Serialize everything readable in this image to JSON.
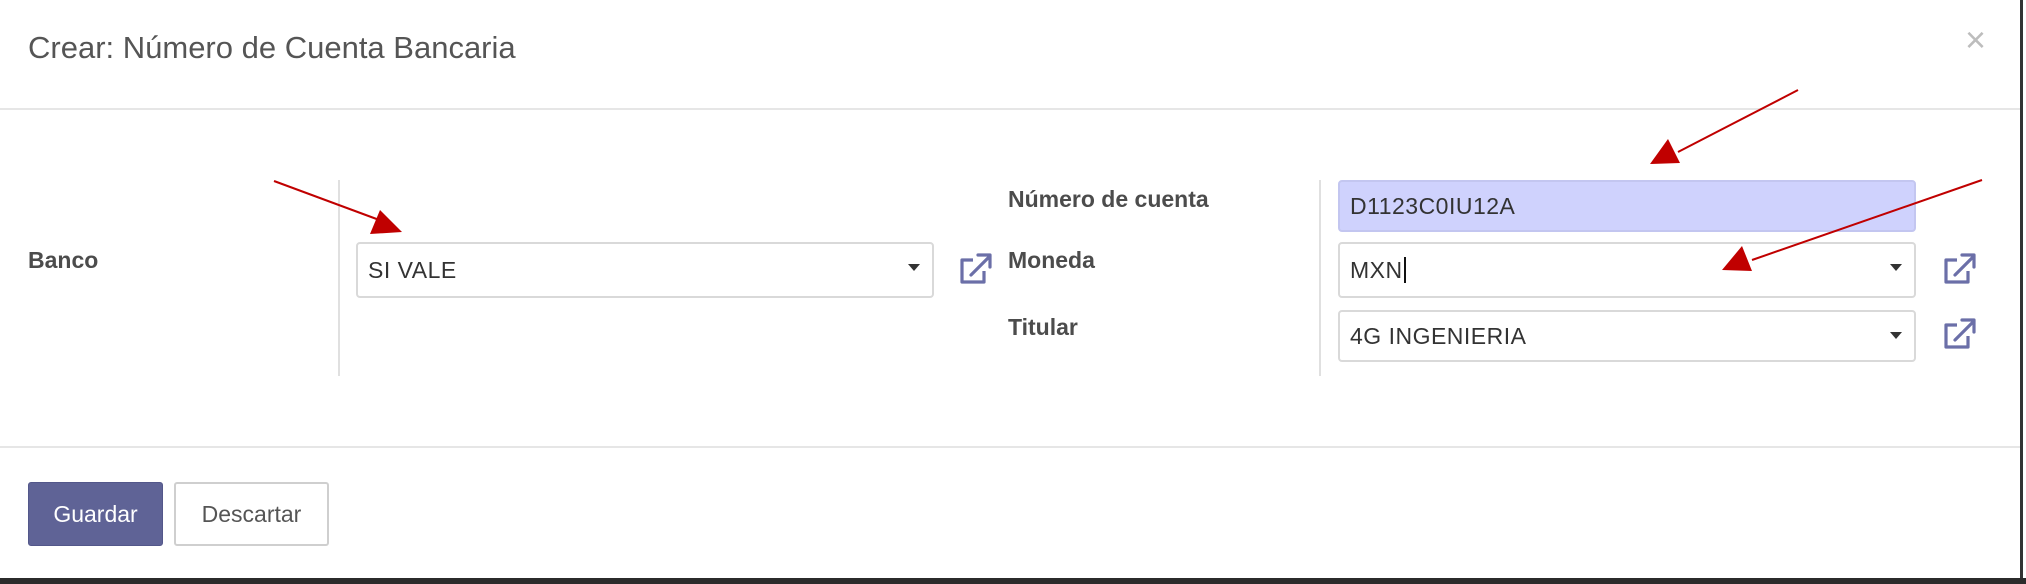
{
  "dialog": {
    "title": "Crear: Número de Cuenta Bancaria",
    "close_glyph": "×"
  },
  "form": {
    "bank": {
      "label": "Banco",
      "value": "SI VALE"
    },
    "account_number": {
      "label": "Número de cuenta",
      "value": "D1123C0IU12A"
    },
    "currency": {
      "label": "Moneda",
      "value": "MXN"
    },
    "holder": {
      "label": "Titular",
      "value": "4G INGENIERIA"
    }
  },
  "footer": {
    "save_label": "Guardar",
    "discard_label": "Descartar"
  },
  "icons": {
    "external_link": "external-link-icon",
    "dropdown": "caret-down-icon",
    "annotation": "red-arrow"
  },
  "colors": {
    "primary_button": "#5f6396",
    "active_field": "#cfd2fd",
    "annotation_arrow": "#c00000",
    "external_link_icon": "#6b6fa8"
  }
}
